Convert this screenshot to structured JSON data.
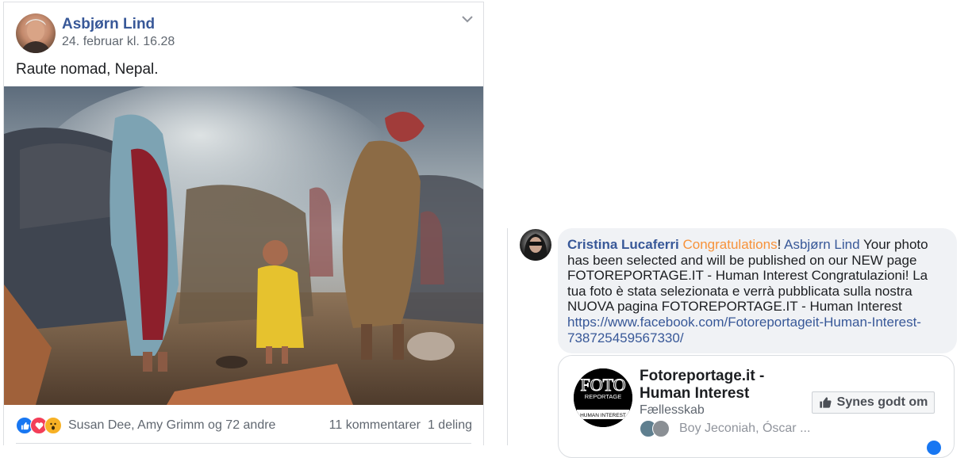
{
  "post": {
    "author": "Asbjørn Lind",
    "timestamp": "24. februar kl. 16.28",
    "caption": "Raute nomad, Nepal.",
    "reactions": {
      "names": "Susan Dee, Amy Grimm og 72 andre",
      "types": [
        "like-icon",
        "love-icon",
        "wow-icon"
      ]
    },
    "comments_count": "11 kommentarer",
    "shares_count": "1 deling"
  },
  "comment": {
    "author": "Cristina Lucaferri",
    "congrats_word": "Congratulations",
    "exclamation": "!",
    "mention": "Asbjørn Lind",
    "text": " Your photo has been selected and will be published on our NEW page FOTOREPORTAGE.IT - Human Interest Congratulazioni! La tua foto è stata selezionata e verrà pubblicata sulla nostra NUOVA pagina FOTOREPORTAGE.IT - Human Interest",
    "link": "https://www.facebook.com/Fotoreportageit-Human-Interest-738725459567330/"
  },
  "page_card": {
    "logo_text_top": "FOTO",
    "logo_text_mid": "REPORTAGE",
    "logo_text_bottom": "HUMAN INTEREST",
    "title": "Fotoreportage.it - Human Interest",
    "category": "Fællesskab",
    "friends": "Boy Jeconiah, Óscar ...",
    "like_button": "Synes godt om"
  },
  "colors": {
    "link_blue": "#385898",
    "congrats_orange": "#f7923a",
    "secondary_text": "#606770"
  }
}
